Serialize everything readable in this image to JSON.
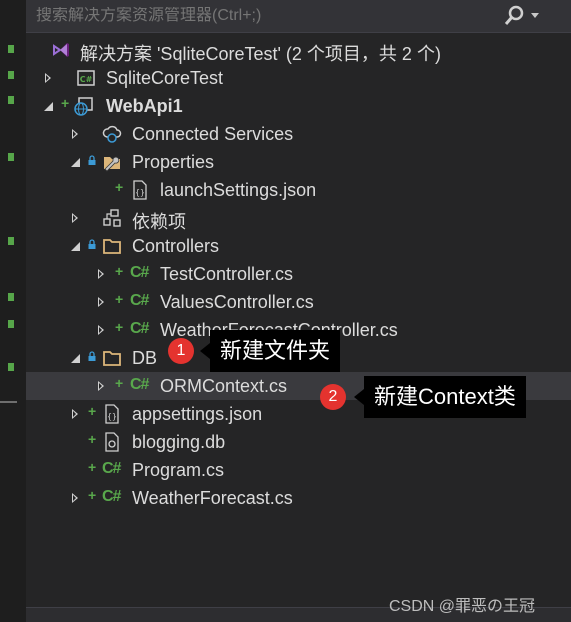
{
  "search": {
    "placeholder": "搜索解决方案资源管理器(Ctrl+;)"
  },
  "solution": {
    "label": "解决方案 'SqliteCoreTest' (2 个项目，共 2 个)"
  },
  "tree": {
    "items": [
      {
        "label": "SqliteCoreTest"
      },
      {
        "label": "WebApi1"
      },
      {
        "label": "Connected Services"
      },
      {
        "label": "Properties"
      },
      {
        "label": "launchSettings.json"
      },
      {
        "label": "依赖项"
      },
      {
        "label": "Controllers"
      },
      {
        "label": "TestController.cs"
      },
      {
        "label": "ValuesController.cs"
      },
      {
        "label": "WeatherForecastController.cs"
      },
      {
        "label": "DB"
      },
      {
        "label": "ORMContext.cs"
      },
      {
        "label": "appsettings.json"
      },
      {
        "label": "blogging.db"
      },
      {
        "label": "Program.cs"
      },
      {
        "label": "WeatherForecast.cs"
      }
    ],
    "cs_icon": "C#"
  },
  "annotations": {
    "step1": {
      "number": "1",
      "text": "新建文件夹"
    },
    "step2": {
      "number": "2",
      "text": "新建Context类"
    }
  },
  "watermark": "CSDN @罪恶の王冠",
  "colors": {
    "accent_green": "#59a84c",
    "badge_red": "#e4332f",
    "selection": "#3a3a3e"
  }
}
